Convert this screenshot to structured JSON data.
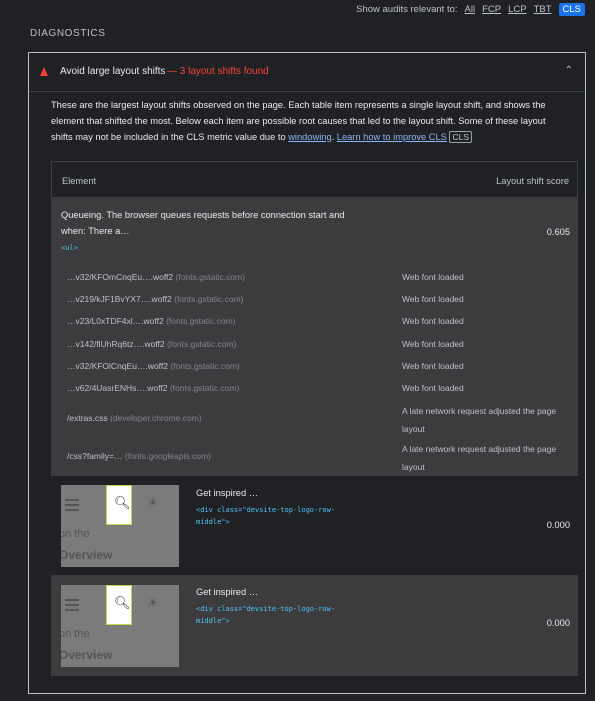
{
  "topbar": {
    "label": "Show audits relevant to:",
    "filters": [
      "All",
      "FCP",
      "LCP",
      "TBT",
      "CLS"
    ]
  },
  "section_title": "DIAGNOSTICS",
  "audit": {
    "title": "Avoid large layout shifts",
    "summary": "— 3 layout shifts found",
    "chevron": "⌃",
    "description_text": "These are the largest layout shifts observed on the page. Each table item represents a single layout shift, and shows the element that shifted the most. Below each item are possible root causes that led to the layout shift. Some of these layout shifts may not be included in the CLS metric value due to ",
    "windowing_link": "windowing",
    "learn_link": "Learn how to improve CLS",
    "badge": "CLS",
    "columns": [
      "Element",
      "Layout shift score"
    ],
    "items": [
      {
        "text_line1": "Queueing. The browser queues requests before connection start and",
        "text_line2": "when: There a…",
        "code": "<ul>",
        "score": "0.605",
        "causes": [
          {
            "url": "…v32/KFOmCnqEu….woff2",
            "host": "(fonts.gstatic.com)",
            "reason": "Web font loaded"
          },
          {
            "url": "…v219/kJF1BvYX7….woff2",
            "host": "(fonts.gstatic.com)",
            "reason": "Web font loaded"
          },
          {
            "url": "…v23/L0xTDF4xl….woff2",
            "host": "(fonts.gstatic.com)",
            "reason": "Web font loaded"
          },
          {
            "url": "…v142/flUhRq6tz….woff2",
            "host": "(fonts.gstatic.com)",
            "reason": "Web font loaded"
          },
          {
            "url": "…v32/KFOlCnqEu….woff2",
            "host": "(fonts.gstatic.com)",
            "reason": "Web font loaded"
          },
          {
            "url": "…v62/4UasrENHs….woff2",
            "host": "(fonts.gstatic.com)",
            "reason": "Web font loaded"
          },
          {
            "url": "/extras.css",
            "host": "(developer.chrome.com)",
            "reason": "A late network request adjusted the page layout"
          },
          {
            "url": "/css?family=…",
            "host": "(fonts.googleapis.com)",
            "reason": "A late network request adjusted the page layout"
          }
        ]
      },
      {
        "text": "Get inspired …",
        "code_line1": "<div class=\"devsite-top-logo-row-",
        "code_line2": "middle\">",
        "score": "0.000",
        "thumb_text1": "on the",
        "thumb_text2": "Overview"
      },
      {
        "text": "Get inspired …",
        "code_line1": "<div class=\"devsite-top-logo-row-",
        "code_line2": "middle\">",
        "score": "0.000",
        "thumb_text1": "on the",
        "thumb_text2": "Overview"
      }
    ]
  },
  "icons": {
    "warning": "warning-triangle-icon",
    "search": "search-icon",
    "theme": "sun-icon",
    "menu": "menu-icon"
  },
  "colors": {
    "accent": "#1a73e8",
    "fail": "#f44336",
    "code": "#4fc3f7"
  }
}
